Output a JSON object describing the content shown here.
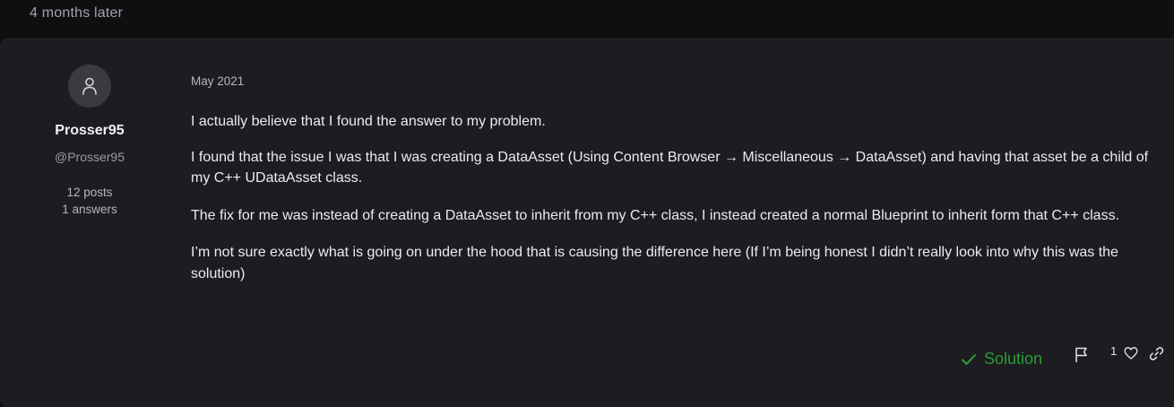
{
  "timeline": {
    "gap_label": "4 months later"
  },
  "post": {
    "author": {
      "name": "Prosser95",
      "handle": "@Prosser95",
      "posts": "12 posts",
      "answers": "1 answers",
      "avatar_icon": "user-icon"
    },
    "date": "May 2021",
    "paragraphs": [
      "I actually believe that I found the answer to my problem.",
      "I found that the issue I was that I was creating a DataAsset (Using Content Browser → Miscellaneous → DataAsset) and having that asset be a child of my C++ UDataAsset class.",
      "The fix for me was instead of creating a DataAsset to inherit from my C++ class, I instead created a normal Blueprint to inherit form that C++ class.",
      "I’m not sure exactly what is going on under the hood that is causing the difference here (If I’m being honest I didn’t really look into why this was the solution)"
    ],
    "actions": {
      "solution_label": "Solution",
      "solution_icon": "check-icon",
      "flag_icon": "flag-icon",
      "like_count": "1",
      "like_icon": "heart-icon",
      "link_icon": "link-icon"
    }
  },
  "colors": {
    "background": "#0f0f11",
    "card": "#1c1c21",
    "solution_green": "#2a9d35",
    "avatar_bg": "#3a3a40"
  }
}
